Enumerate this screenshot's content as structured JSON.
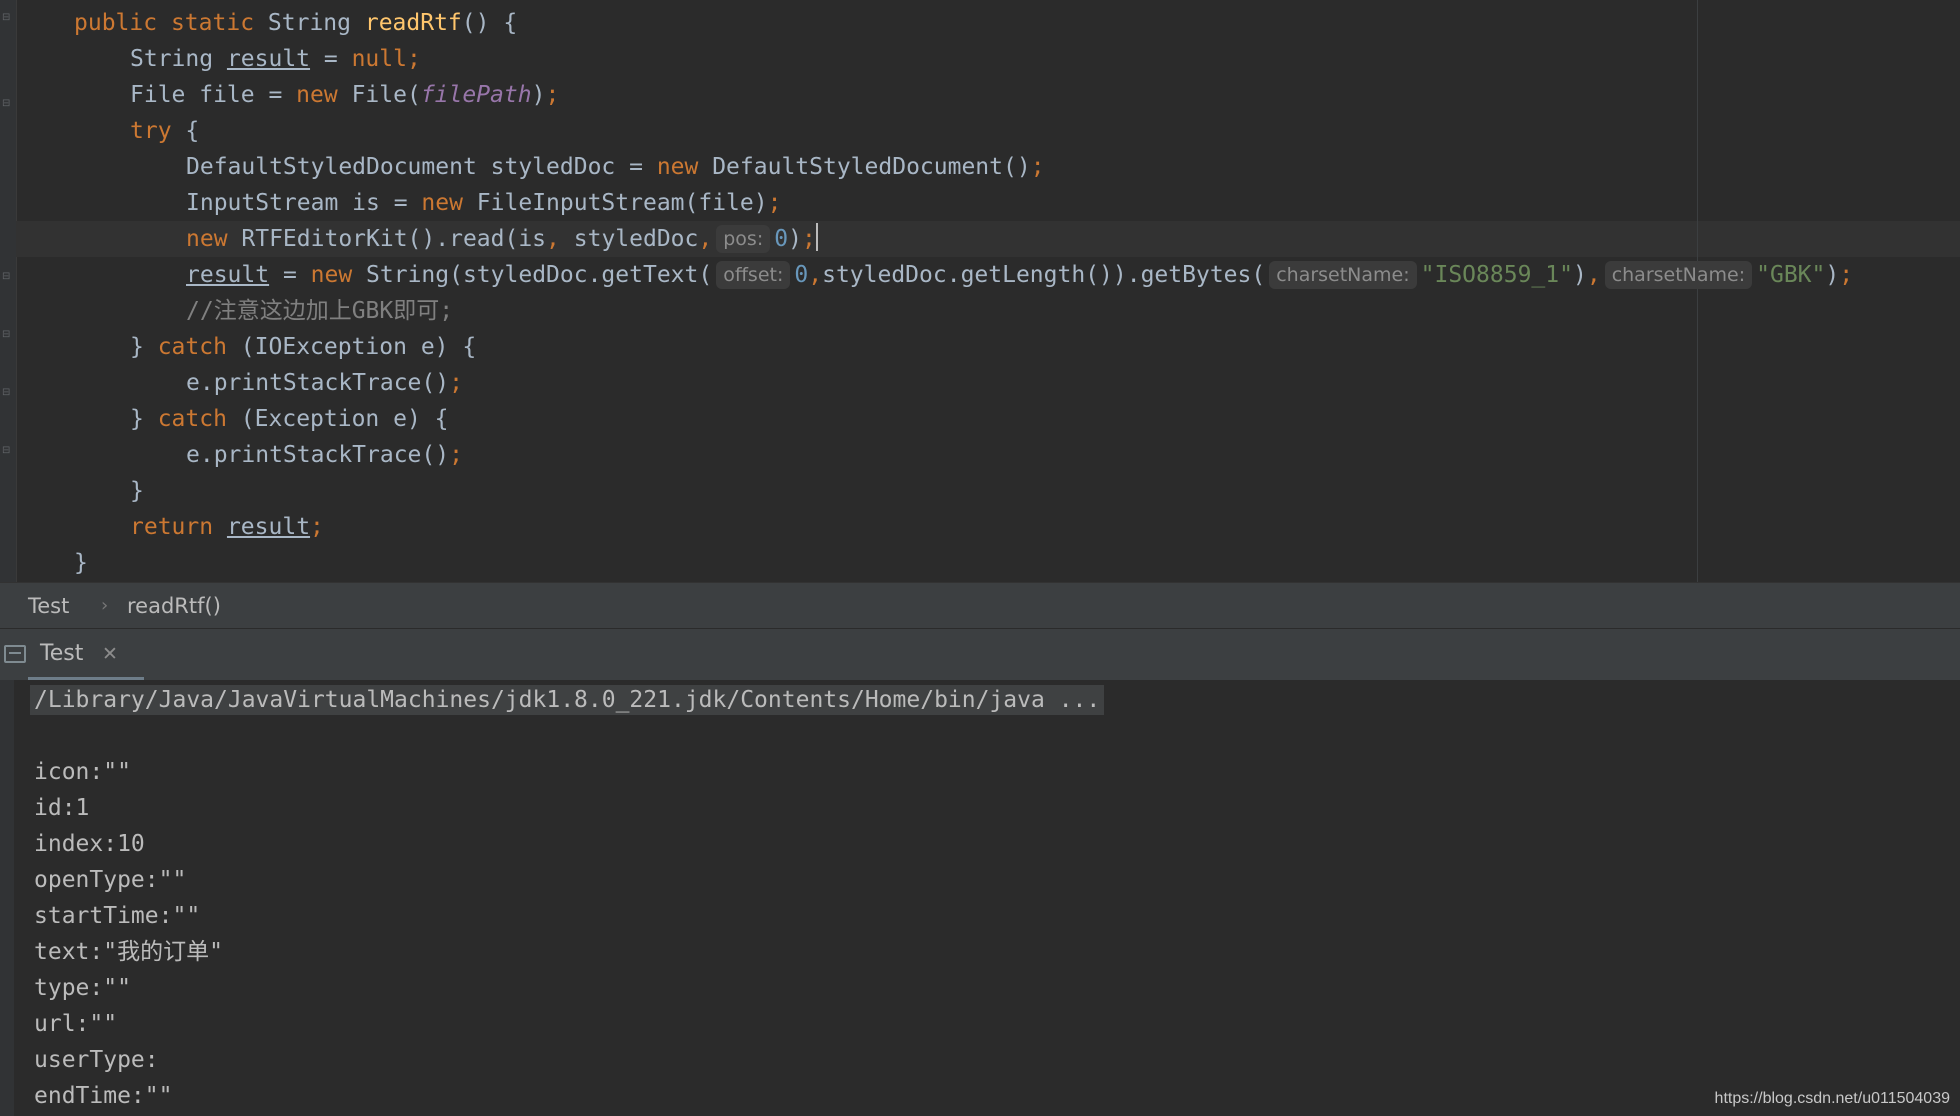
{
  "editor": {
    "lines": {
      "l0": {
        "kw_public": "public",
        "sp1": " ",
        "kw_static": "static",
        "sp2": " ",
        "type": "String ",
        "fn": "readRtf",
        "rest": "() {"
      },
      "l1": {
        "type": "String ",
        "var": "result",
        "eq": " = ",
        "kw_null": "null",
        "semi": ";"
      },
      "l2": {
        "a": "File file = ",
        "kw_new": "new",
        "b": " File(",
        "field": "filePath",
        "c": ")",
        "semi": ";"
      },
      "l3": {
        "kw_try": "try",
        "rest": " {"
      },
      "l4": {
        "a": "DefaultStyledDocument styledDoc = ",
        "kw_new": "new",
        "b": " DefaultStyledDocument()",
        "semi": ";"
      },
      "l5": {
        "a": "InputStream is = ",
        "kw_new": "new",
        "b": " FileInputStream(file)",
        "semi": ";"
      },
      "l6": {
        "kw_new": "new",
        "a": " RTFEditorKit().read(is",
        "comma1": ",",
        "b": " styledDoc",
        "comma2": ",",
        "hint": "pos:",
        "num": "0",
        "c": ")",
        "semi": ";"
      },
      "l7": {
        "var": "result",
        "eq": " = ",
        "kw_new": "new",
        "a": " String(styledDoc.getText(",
        "hint1": "offset:",
        "num": "0",
        "comma1": ",",
        "b": "styledDoc.getLength()).getBytes(",
        "hint2": "charsetName:",
        "str1": "\"ISO8859_1\"",
        "c": ")",
        "comma2": ",",
        "hint3": "charsetName:",
        "str2": "\"GBK\"",
        "d": ")",
        "semi": ";"
      },
      "l8": {
        "comment": "//注意这边加上GBK即可;"
      },
      "l9": {
        "a": "} ",
        "kw_catch": "catch",
        "b": " (IOException e) {"
      },
      "l10": {
        "a": "e.printStackTrace()",
        "semi": ";"
      },
      "l11": {
        "a": "} ",
        "kw_catch": "catch",
        "b": " (Exception e) {"
      },
      "l12": {
        "a": "e.printStackTrace()",
        "semi": ";"
      },
      "l13": {
        "a": "}"
      },
      "l14": {
        "kw_return": "return",
        "sp": " ",
        "var": "result",
        "semi": ";"
      },
      "l15": {
        "a": "}"
      }
    }
  },
  "breadcrumb": {
    "class": "Test",
    "separator": "›",
    "method": "readRtf()"
  },
  "run_panel": {
    "tab_label": "Test",
    "close_glyph": "✕"
  },
  "console": {
    "command": "/Library/Java/JavaVirtualMachines/jdk1.8.0_221.jdk/Contents/Home/bin/java ...",
    "output": [
      "icon:\"\"",
      "id:1",
      "index:10",
      "openType:\"\"",
      "startTime:\"\"",
      "text:\"我的订单\"",
      "type:\"\"",
      "url:\"\"",
      "userType:",
      "endTime:\"\""
    ]
  },
  "watermark": "https://blog.csdn.net/u011504039",
  "colors": {
    "background": "#2b2b2b",
    "keyword": "#cc7832",
    "function": "#ffc66d",
    "field": "#9876aa",
    "number": "#6897bb",
    "string": "#6a8759",
    "comment": "#808080"
  }
}
